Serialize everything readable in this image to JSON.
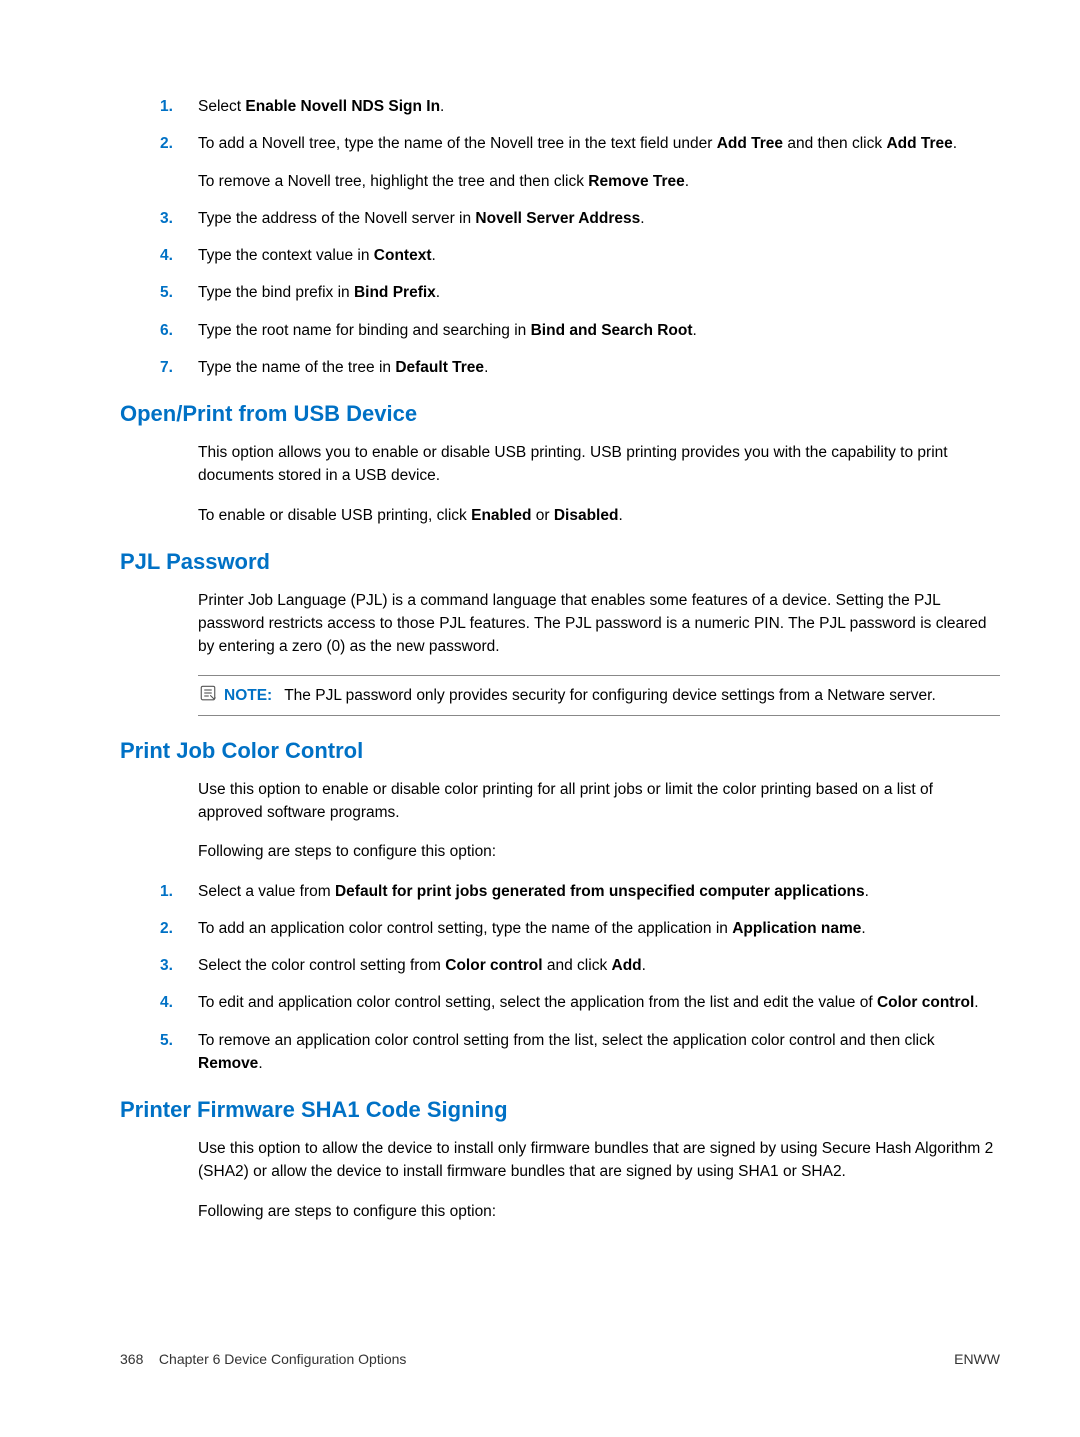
{
  "lists": {
    "novell": [
      {
        "num": "1.",
        "html": "Select <b>Enable Novell NDS Sign In</b>."
      },
      {
        "num": "2.",
        "html": "To add a Novell tree, type the name of the Novell tree in the text field under <b>Add Tree</b> and then click <b>Add Tree</b>.",
        "sub": "To remove a Novell tree, highlight the tree and then click <b>Remove Tree</b>."
      },
      {
        "num": "3.",
        "html": "Type the address of the Novell server in <b>Novell Server Address</b>."
      },
      {
        "num": "4.",
        "html": "Type the context value in <b>Context</b>."
      },
      {
        "num": "5.",
        "html": "Type the bind prefix in <b>Bind Prefix</b>."
      },
      {
        "num": "6.",
        "html": "Type the root name for binding and searching in <b>Bind and Search Root</b>."
      },
      {
        "num": "7.",
        "html": "Type the name of the tree in <b>Default Tree</b>."
      }
    ],
    "color": [
      {
        "num": "1.",
        "html": "Select a value from <b>Default for print jobs generated from unspecified computer applications</b>."
      },
      {
        "num": "2.",
        "html": "To add an application color control setting, type the name of the application in <b>Application name</b>."
      },
      {
        "num": "3.",
        "html": "Select the color control setting from <b>Color control</b> and click <b>Add</b>."
      },
      {
        "num": "4.",
        "html": "To edit and application color control setting, select the application from the list and edit the value of <b>Color control</b>."
      },
      {
        "num": "5.",
        "html": "To remove an application color control setting from the list, select the application color control and then click <b>Remove</b>."
      }
    ]
  },
  "sections": {
    "usb": {
      "heading": "Open/Print from USB Device",
      "p1": "This option allows you to enable or disable USB printing. USB printing provides you with the capability to print documents stored in a USB device.",
      "p2": "To enable or disable USB printing, click <b>Enabled</b> or <b>Disabled</b>."
    },
    "pjl": {
      "heading": "PJL Password",
      "p1": "Printer Job Language (PJL) is a command language that enables some features of a device. Setting the PJL password restricts access to those PJL features. The PJL password is a numeric PIN. The PJL password is cleared by entering a zero (0) as the new password.",
      "note_label": "NOTE:",
      "note_text": "The PJL password only provides security for configuring device settings from a Netware server."
    },
    "color": {
      "heading": "Print Job Color Control",
      "p1": "Use this option to enable or disable color printing for all print jobs or limit the color printing based on a list of approved software programs.",
      "p2": "Following are steps to configure this option:"
    },
    "sha1": {
      "heading": "Printer Firmware SHA1 Code Signing",
      "p1": "Use this option to allow the device to install only firmware bundles that are signed by using Secure Hash Algorithm 2 (SHA2) or allow the device to install firmware bundles that are signed by using SHA1 or SHA2.",
      "p2": "Following are steps to configure this option:"
    }
  },
  "footer": {
    "left_pagenum": "368",
    "left_chapter": "Chapter 6   Device Configuration Options",
    "right": "ENWW"
  }
}
